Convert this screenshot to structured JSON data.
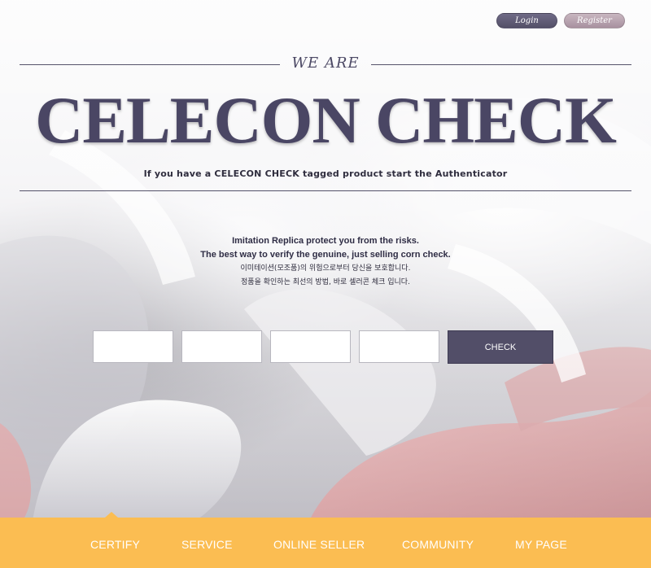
{
  "auth": {
    "login_label": "Login",
    "register_label": "Register"
  },
  "hero": {
    "kicker": "WE ARE",
    "title": "CELECON CHECK",
    "tagline": "If you have a CELECON CHECK tagged product start the Authenticator"
  },
  "info": {
    "line1": "Imitation Replica protect you from the risks.",
    "line2": "The best way to verify the genuine, just selling corn check.",
    "line3": "이미테이션(모조품)의 위험으로부터 당신을 보호합니다.",
    "line4": "정품을 확인하는 최선의 방법, 바로 셀러콘 체크 입니다."
  },
  "form": {
    "inputs": [
      "",
      "",
      "",
      ""
    ],
    "check_label": "CHECK"
  },
  "nav": {
    "items": [
      "CERTIFY",
      "SERVICE",
      "ONLINE SELLER",
      "COMMUNITY",
      "MY PAGE"
    ]
  },
  "colors": {
    "brand": "#4a4664",
    "nav_bg": "#fbbd52",
    "button": "#524e68",
    "login_pill": "#625d7a",
    "register_pill": "#b8a3b0"
  }
}
